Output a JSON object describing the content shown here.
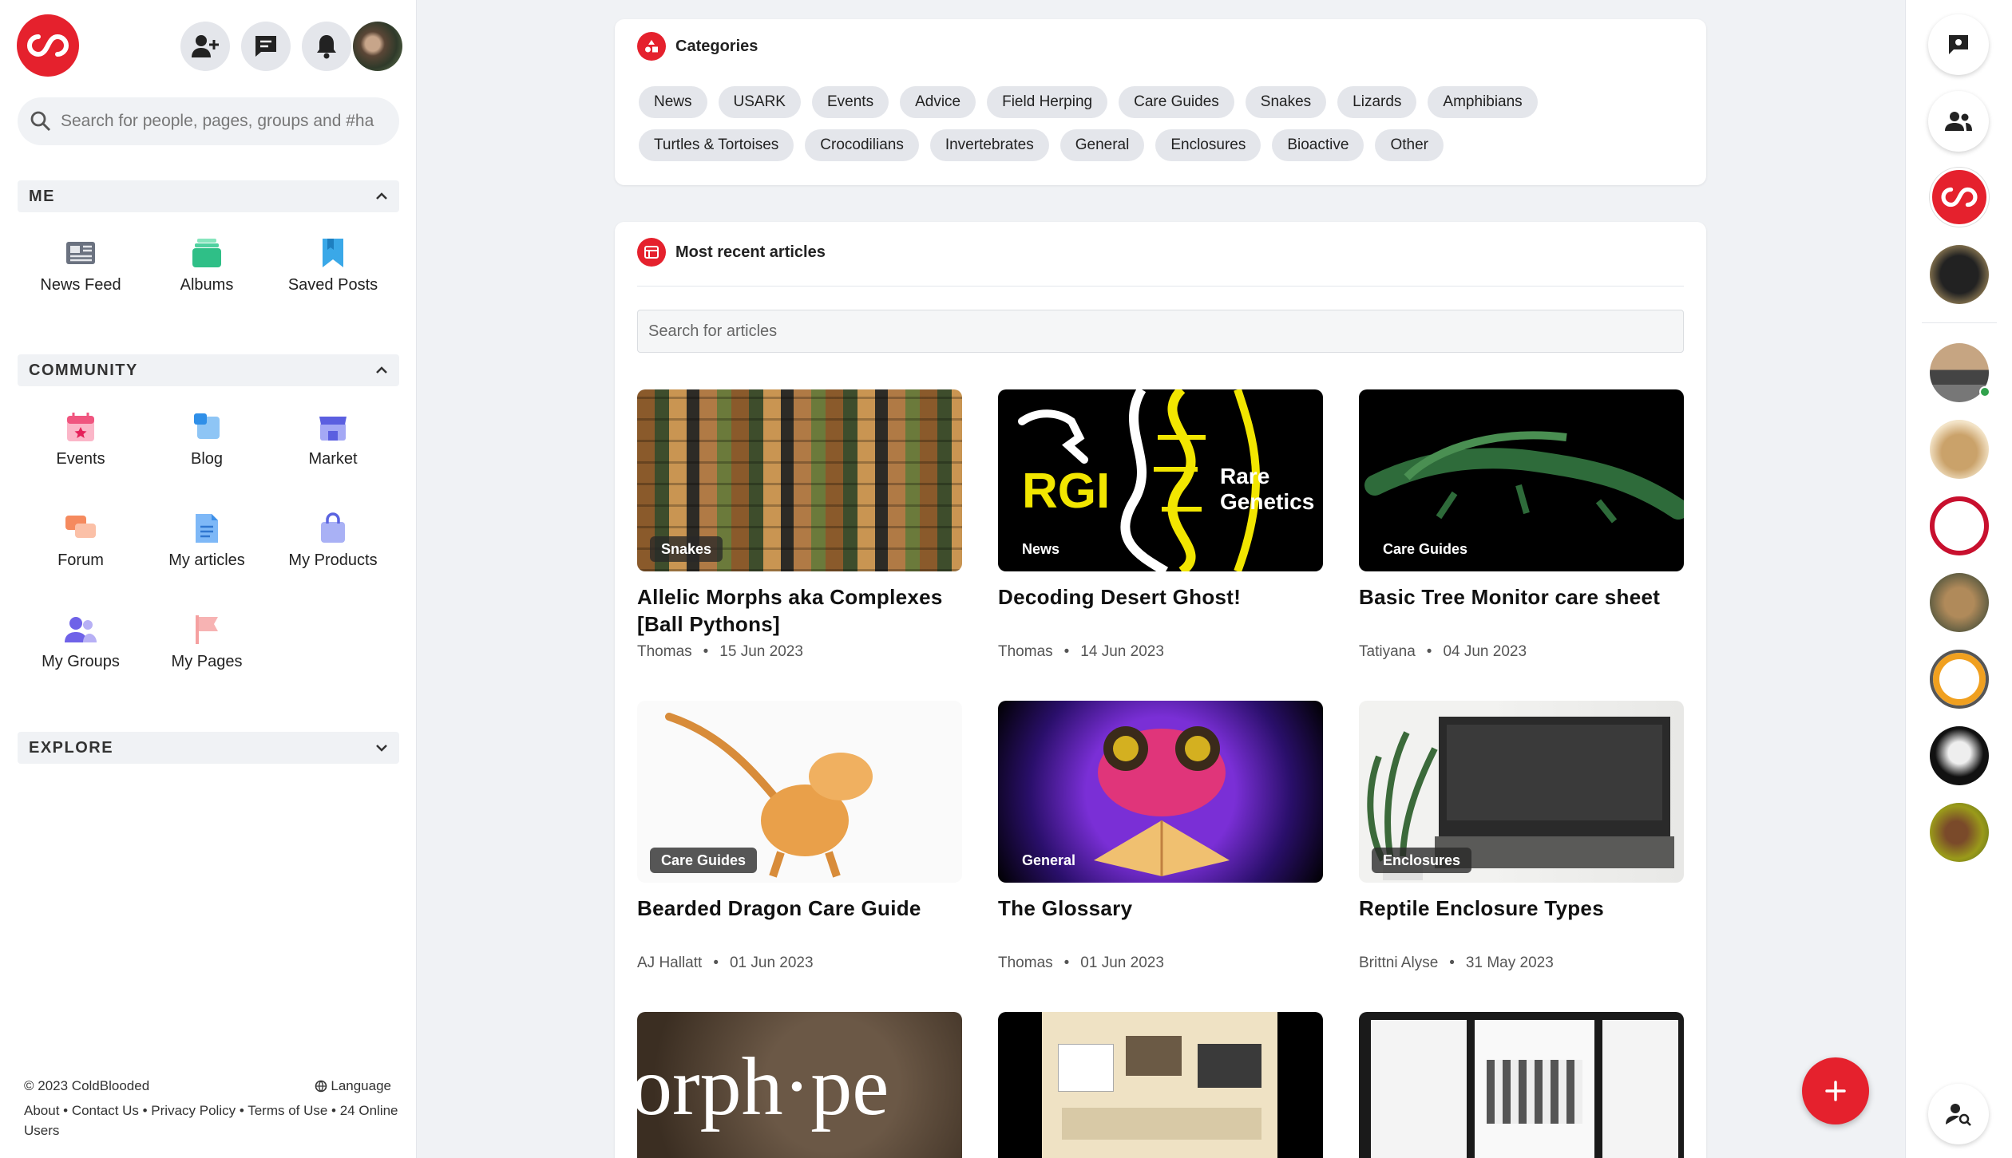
{
  "top": {
    "search_placeholder": "Search for people, pages, groups and #ha"
  },
  "me": {
    "header": "ME",
    "items": [
      {
        "label": "News Feed",
        "icon": "newspaper-icon"
      },
      {
        "label": "Albums",
        "icon": "albums-icon"
      },
      {
        "label": "Saved Posts",
        "icon": "bookmark-icon"
      }
    ]
  },
  "community": {
    "header": "COMMUNITY",
    "items": [
      {
        "label": "Events",
        "icon": "calendar-icon"
      },
      {
        "label": "Blog",
        "icon": "blog-icon"
      },
      {
        "label": "Market",
        "icon": "store-icon"
      },
      {
        "label": "Forum",
        "icon": "forum-icon"
      },
      {
        "label": "My articles",
        "icon": "document-icon"
      },
      {
        "label": "My Products",
        "icon": "shopping-bag-icon"
      },
      {
        "label": "My Groups",
        "icon": "groups-icon"
      },
      {
        "label": "My Pages",
        "icon": "flag-icon"
      }
    ]
  },
  "explore": {
    "header": "EXPLORE"
  },
  "footer": {
    "copyright": "© 2023 ColdBlooded",
    "language": "Language",
    "links": "About • Contact Us • Privacy Policy • Terms of Use • 24 Online Users"
  },
  "categories": {
    "title": "Categories",
    "items": [
      "News",
      "USARK",
      "Events",
      "Advice",
      "Field Herping",
      "Care Guides",
      "Snakes",
      "Lizards",
      "Amphibians",
      "Turtles & Tortoises",
      "Crocodilians",
      "Invertebrates",
      "General",
      "Enclosures",
      "Bioactive",
      "Other"
    ]
  },
  "articles": {
    "title": "Most recent articles",
    "search_placeholder": "Search for articles",
    "items": [
      {
        "badge": "Snakes",
        "title": "Allelic Morphs aka Complexes [Ball Pythons]",
        "author": "Thomas",
        "date": "15 Jun 2023"
      },
      {
        "badge": "News",
        "title": "Decoding Desert Ghost!",
        "author": "Thomas",
        "date": "14 Jun 2023"
      },
      {
        "badge": "Care Guides",
        "title": "Basic Tree Monitor care sheet",
        "author": "Tatiyana",
        "date": "04 Jun 2023"
      },
      {
        "badge": "Care Guides",
        "title": "Bearded Dragon Care Guide",
        "author": "AJ Hallatt",
        "date": "01 Jun 2023"
      },
      {
        "badge": "General",
        "title": "The Glossary",
        "author": "Thomas",
        "date": "01 Jun 2023"
      },
      {
        "badge": "Enclosures",
        "title": "Reptile Enclosure Types",
        "author": "Brittni Alyse",
        "date": "31 May 2023"
      }
    ],
    "thumb_texts": {
      "rgi": "RGI",
      "rare": "Rare",
      "genetics": "Genetics",
      "morph": "orph·pe"
    }
  },
  "colors": {
    "brand": "#e5212d",
    "chip_bg": "#e4e6eb",
    "page_bg": "#f0f2f5"
  }
}
